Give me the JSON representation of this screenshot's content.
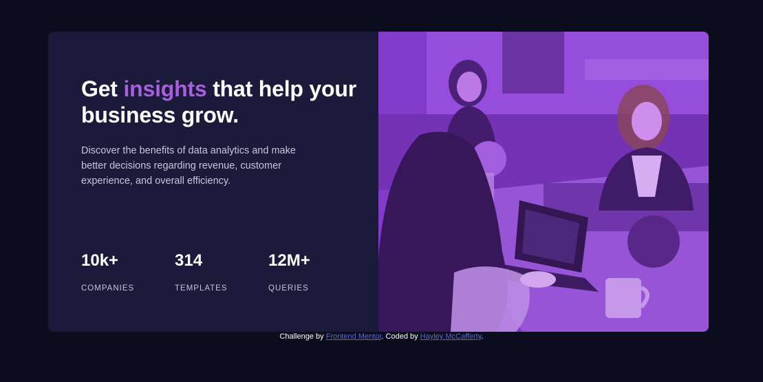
{
  "hero": {
    "heading_part1": "Get ",
    "heading_accent": "insights",
    "heading_part2": " that help your business grow.",
    "description": "Discover the benefits of data analytics and make better decisions regarding revenue, customer experience, and overall efficiency."
  },
  "stats": [
    {
      "value": "10k+",
      "label": "COMPANIES"
    },
    {
      "value": "314",
      "label": "TEMPLATES"
    },
    {
      "value": "12M+",
      "label": "QUERIES"
    }
  ],
  "attribution": {
    "prefix": "Challenge by ",
    "link1": "Frontend Mentor",
    "middle": ". Coded by ",
    "link2": "Hayley McCafferty",
    "suffix": "."
  },
  "colors": {
    "page_background": "#0b0c1e",
    "card_background": "#1c1a3b",
    "accent": "#a95fe0",
    "photo_overlay": "#8b3bd9",
    "link": "#5a6bd0"
  }
}
